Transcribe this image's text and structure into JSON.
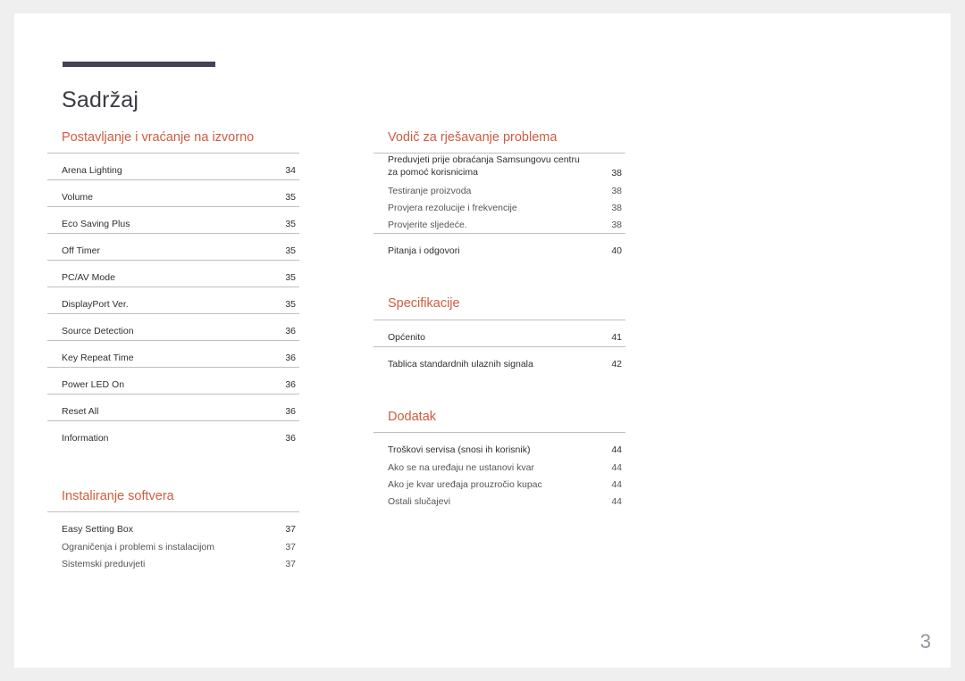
{
  "document": {
    "title": "Sadržaj",
    "folio": "3",
    "accent_color": "#cf5c41",
    "rule_color": "#474156",
    "folio_color": "#8e97a6"
  },
  "columns": {
    "left": [
      {
        "heading": "Postavljanje i vraćanje na izvorno",
        "entries": [
          {
            "label": "Arena Lighting",
            "page": "34",
            "level": "main"
          },
          {
            "label": "Volume",
            "page": "35",
            "level": "main"
          },
          {
            "label": "Eco Saving Plus",
            "page": "35",
            "level": "main"
          },
          {
            "label": "Off Timer",
            "page": "35",
            "level": "main"
          },
          {
            "label": "PC/AV Mode",
            "page": "35",
            "level": "main"
          },
          {
            "label": "DisplayPort Ver.",
            "page": "35",
            "level": "main"
          },
          {
            "label": "Source Detection",
            "page": "36",
            "level": "main"
          },
          {
            "label": "Key Repeat Time",
            "page": "36",
            "level": "main"
          },
          {
            "label": "Power LED On",
            "page": "36",
            "level": "main"
          },
          {
            "label": "Reset All",
            "page": "36",
            "level": "main"
          },
          {
            "label": "Information",
            "page": "36",
            "level": "main"
          }
        ]
      },
      {
        "heading": "Instaliranje softvera",
        "entries": [
          {
            "label": "Easy Setting Box",
            "page": "37",
            "level": "main"
          },
          {
            "label": "Ograničenja i problemi s instalacijom",
            "page": "37",
            "level": "sub"
          },
          {
            "label": "Sistemski preduvjeti",
            "page": "37",
            "level": "sub"
          }
        ]
      }
    ],
    "right": [
      {
        "heading": "Vodič za rješavanje problema",
        "entries": [
          {
            "label": "Preduvjeti prije obraćanja Samsungovu centru za pomoć korisnicima",
            "page": "38",
            "level": "main",
            "wrap": true
          },
          {
            "label": "Testiranje proizvoda",
            "page": "38",
            "level": "sub"
          },
          {
            "label": "Provjera rezolucije i frekvencije",
            "page": "38",
            "level": "sub"
          },
          {
            "label": "Provjerite sljedeće.",
            "page": "38",
            "level": "sub"
          },
          {
            "label": "Pitanja i odgovori",
            "page": "40",
            "level": "main"
          }
        ]
      },
      {
        "heading": "Specifikacije",
        "entries": [
          {
            "label": "Općenito",
            "page": "41",
            "level": "main"
          },
          {
            "label": "Tablica standardnih ulaznih signala",
            "page": "42",
            "level": "main"
          }
        ]
      },
      {
        "heading": "Dodatak",
        "entries": [
          {
            "label": "Troškovi servisa (snosi ih korisnik)",
            "page": "44",
            "level": "main"
          },
          {
            "label": "Ako se na uređaju ne ustanovi kvar",
            "page": "44",
            "level": "sub"
          },
          {
            "label": "Ako je kvar uređaja prouzročio kupac",
            "page": "44",
            "level": "sub"
          },
          {
            "label": "Ostali slučajevi",
            "page": "44",
            "level": "sub"
          }
        ]
      }
    ]
  }
}
